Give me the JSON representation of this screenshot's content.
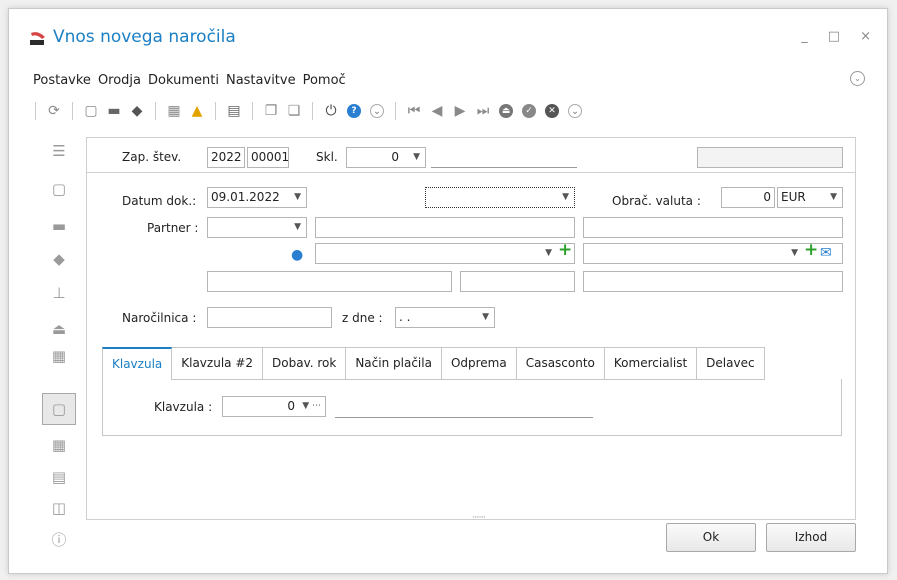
{
  "window": {
    "title": "Vnos novega naročila",
    "controls": [
      "_",
      "□",
      "×"
    ]
  },
  "menu": [
    "Postavke",
    "Orodja",
    "Dokumenti",
    "Nastavitve",
    "Pomoč"
  ],
  "header": {
    "zap_label": "Zap. štev.",
    "zap_year": "2022",
    "zap_num": "00001",
    "skl_label": "Skl.",
    "skl_value": "0"
  },
  "form": {
    "datum_label": "Datum dok.:",
    "datum_value": "09.01.2022",
    "obrac_label": "Obrač. valuta :",
    "obrac_value": "0",
    "currency": "EUR",
    "partner_label": "Partner :",
    "narocilnica_label": "Naročilnica :",
    "zdne_label": "z dne :",
    "zdne_value": ". ."
  },
  "tabs": [
    "Klavzula",
    "Klavzula #2",
    "Dobav. rok",
    "Način plačila",
    "Odprema",
    "Casasconto",
    "Komercialist",
    "Delavec"
  ],
  "active_tab": "Klavzula",
  "klavzula": {
    "label": "Klavzula :",
    "value": "0"
  },
  "buttons": {
    "ok": "Ok",
    "exit": "Izhod"
  },
  "colors": {
    "accent": "#1a7fc4",
    "green": "#2da02d"
  }
}
